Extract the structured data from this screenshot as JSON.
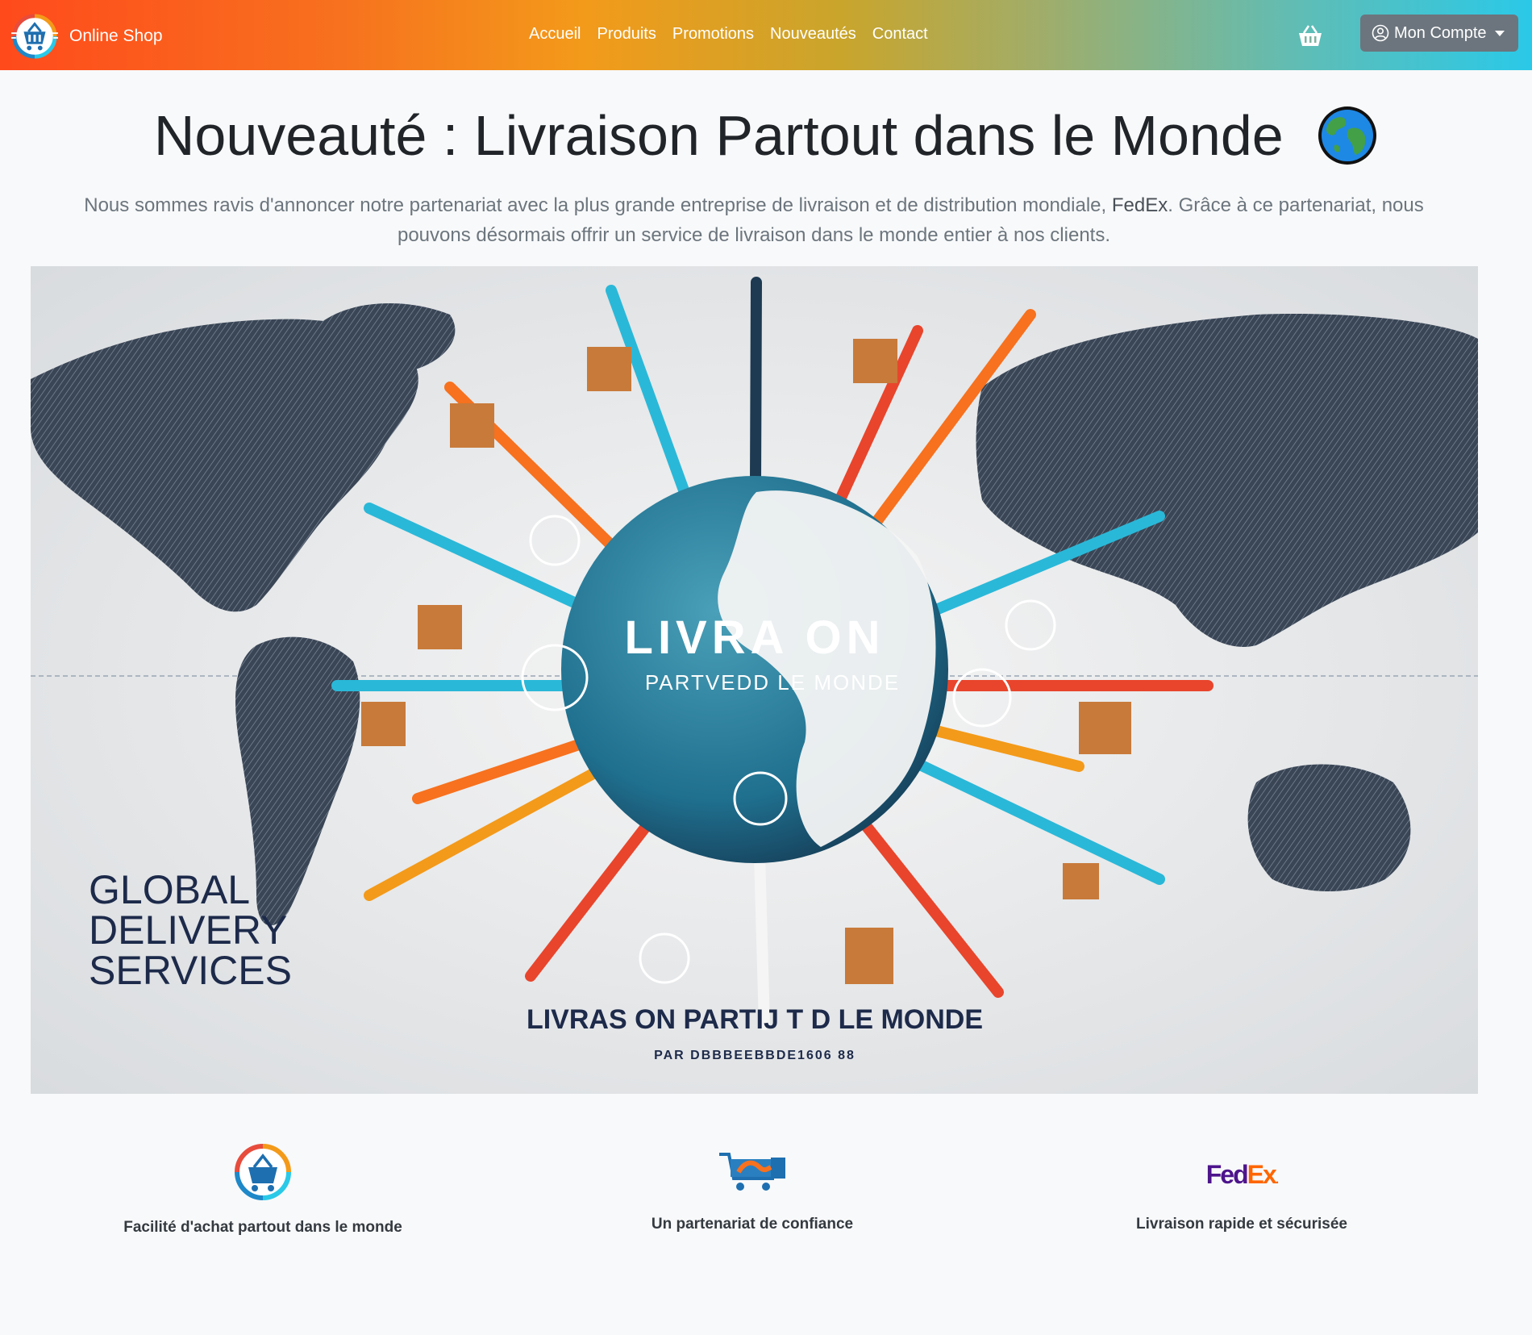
{
  "navbar": {
    "brand": "Online Shop",
    "links": [
      "Accueil",
      "Produits",
      "Promotions",
      "Nouveautés",
      "Contact"
    ],
    "account_label": "Mon Compte",
    "colors": {
      "start": "#ff4a1c",
      "middle": "#f39a1a",
      "end": "#2ac9e8"
    }
  },
  "hero": {
    "title": "Nouveauté : Livraison Partout dans le Monde",
    "lead_before": "Nous sommes ravis d'annoncer notre partenariat avec la plus grande entreprise de livraison et de distribution mondiale,",
    "lead_partner": "FedEx",
    "lead_after": ". Grâce à ce partenariat, nous pouvons désormais offrir un service de livraison dans le monde entier à nos clients."
  },
  "banner": {
    "center_title": "LIVRA ON",
    "center_subtitle": "PARTVEDD LE MONDE",
    "left_text_line1": "GLOBAL",
    "left_text_line2": "DELIVERY",
    "left_text_line3": "SERVICES",
    "bottom_title": "LIVRAS ON PARTIJ T D LE MONDE",
    "bottom_subtitle": "PAR DBBBEEBBDE1606 88"
  },
  "features": [
    {
      "icon": "shopping-basket-icon",
      "label": "Facilité d'achat partout dans le monde"
    },
    {
      "icon": "handshake-cart-icon",
      "label": "Un partenariat de confiance"
    },
    {
      "icon": "fedex-logo",
      "label": "Livraison rapide et sécurisée"
    }
  ],
  "fedex_logo": {
    "fed": "Fed",
    "ex": "Ex",
    "dot": "."
  }
}
